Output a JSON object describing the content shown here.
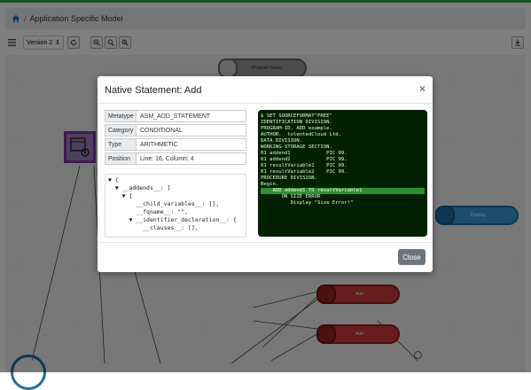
{
  "breadcrumb": {
    "separator": "/",
    "title": "Application Specific Model"
  },
  "toolbar": {
    "version_label": "Version 2",
    "version_arrow": "⇕"
  },
  "canvas": {
    "nodes": [
      {
        "label": "Program Name"
      },
      {
        "label": "Display"
      },
      {
        "label": "Add"
      },
      {
        "label": "Add"
      }
    ]
  },
  "modal": {
    "title": "Native Statement: Add",
    "close_x": "×",
    "properties": [
      {
        "key": "Metatype",
        "value": "ASM_ADD_STATEMENT"
      },
      {
        "key": "Category",
        "value": "CONDITIONAL"
      },
      {
        "key": "Type",
        "value": "ARITHMETIC"
      },
      {
        "key": "Position",
        "value": "Line: 16, Column: 4"
      }
    ],
    "tree_lines": [
      "▼ {",
      "  ▼ __addends__: [",
      "    ▼ {",
      "        __child_variables__: [],",
      "        __fqname__: \"\",",
      "      ▼ __identifier_declaration__: {",
      "          __clauses__: [],"
    ],
    "code_lines": [
      "$ SET SOURCEFORMAT\"FREE\"",
      "IDENTIFICATION DIVISION.",
      "PROGRAM-ID. ADD example.",
      "AUTHOR.  tolentedCloud Ltd.",
      "",
      "DATA DIVISION.",
      "WORKING-STORAGE SECTION.",
      "",
      "01 addend1            PIC 99.",
      "01 addend2            PIC 99.",
      "01 resultVariable1    PIC 99.",
      "01 resultVariable2    PIC 99.",
      "",
      "PROCEDURE DIVISION.",
      "Begin.",
      "    ADD addend1 TO resultVariable1",
      "       ON SIZE ERROR",
      "          Display \"Size Error!\""
    ],
    "highlight_line": 15,
    "close_button": "Close"
  }
}
